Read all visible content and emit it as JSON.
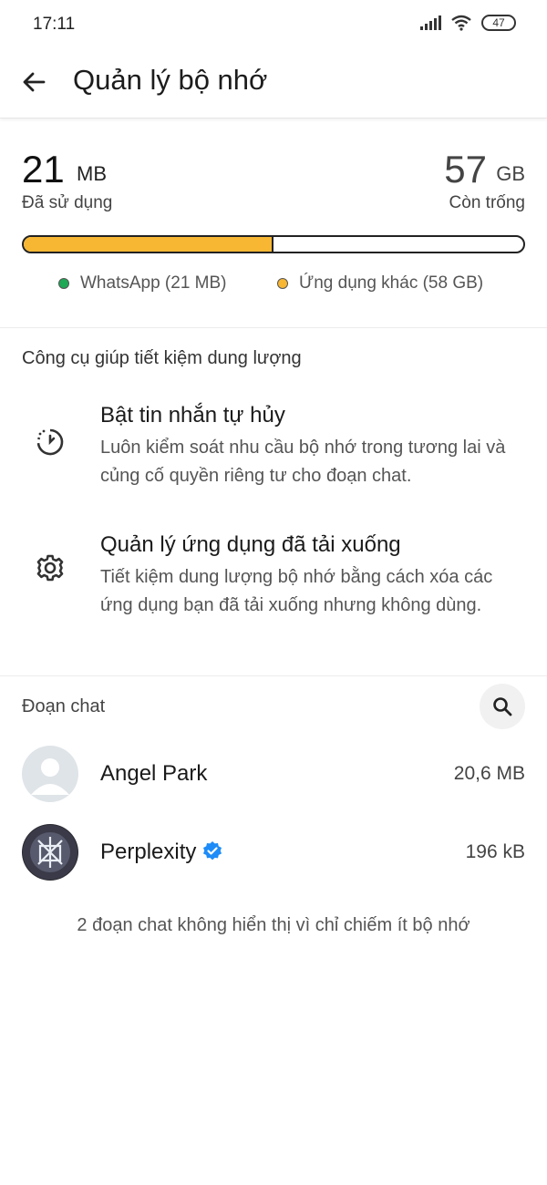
{
  "status_bar": {
    "time": "17:11",
    "battery": "47"
  },
  "header": {
    "title": "Quản lý bộ nhớ"
  },
  "storage": {
    "used_value": "21",
    "used_unit": "MB",
    "used_label": "Đã sử dụng",
    "free_value": "57",
    "free_unit": "GB",
    "free_label": "Còn trống",
    "legend": [
      {
        "label": "WhatsApp (21 MB)",
        "color": "#1fa855"
      },
      {
        "label": "Ứng dụng khác (58 GB)",
        "color": "#f7b733"
      }
    ],
    "bar_fill_fraction": 0.5
  },
  "tools": {
    "section_title": "Công cụ giúp tiết kiệm dung lượng",
    "items": [
      {
        "title": "Bật tin nhắn tự hủy",
        "description": "Luôn kiểm soát nhu cầu bộ nhớ trong tương lai và củng cố quyền riêng tư cho đoạn chat.",
        "icon": "timer-icon"
      },
      {
        "title": "Quản lý ứng dụng đã tải xuống",
        "description": "Tiết kiệm dung lượng bộ nhớ bằng cách xóa các ứng dụng bạn đã tải xuống nhưng không dùng.",
        "icon": "gear-icon"
      }
    ]
  },
  "chats": {
    "section_title": "Đoạn chat",
    "items": [
      {
        "name": "Angel Park",
        "size": "20,6 MB",
        "verified": false
      },
      {
        "name": "Perplexity",
        "size": "196 kB",
        "verified": true
      }
    ],
    "footer_note": "2 đoạn chat không hiển thị vì chỉ chiếm ít bộ nhớ"
  },
  "colors": {
    "accent_yellow": "#f7b733",
    "whatsapp_green": "#1fa855",
    "verified_blue": "#1d8cf8"
  }
}
